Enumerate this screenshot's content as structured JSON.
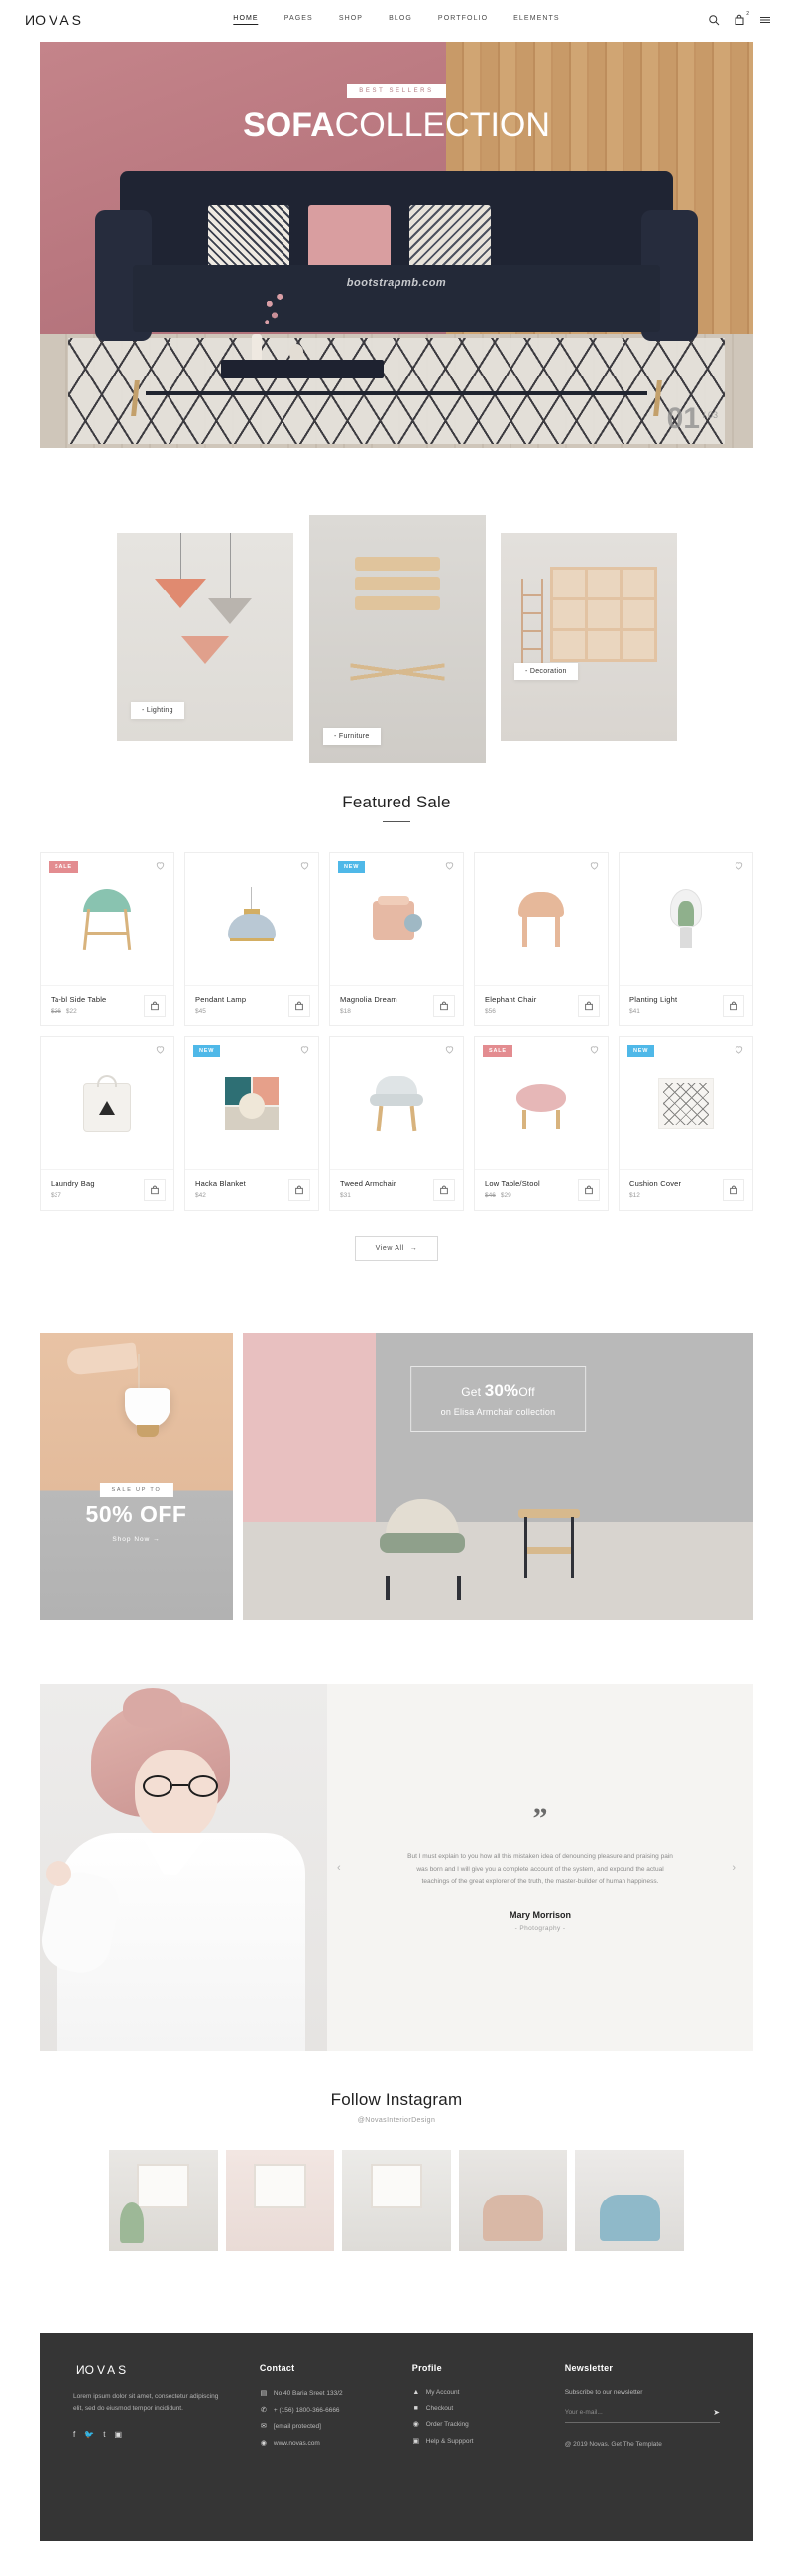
{
  "header": {
    "logo": "NOVAS",
    "nav": [
      {
        "label": "HOME",
        "active": true
      },
      {
        "label": "PAGES",
        "active": false
      },
      {
        "label": "SHOP",
        "active": false
      },
      {
        "label": "BLOG",
        "active": false
      },
      {
        "label": "PORTFOLIO",
        "active": false
      },
      {
        "label": "ELEMENTS",
        "active": false
      }
    ],
    "icons": {
      "search": "search-icon",
      "cart": "bag-icon",
      "cart_count": "2",
      "menu": "hamburger-icon"
    }
  },
  "hero": {
    "badge": "BEST SELLERS",
    "title_bold": "SOFA",
    "title_light": "COLLECTION",
    "watermark": "bootstrapmb.com",
    "slide_current": "01",
    "slide_total": "/ 03"
  },
  "categories": [
    {
      "label": "- Lighting"
    },
    {
      "label": "- Furniture"
    },
    {
      "label": "- Decoration"
    }
  ],
  "featured": {
    "title": "Featured Sale",
    "view_all": "View All",
    "view_all_arrow": "→",
    "products": [
      {
        "name": "Ta-bl Side Table",
        "old_price": "$36",
        "price": "$22",
        "tag": "SALE",
        "tag_type": "sale"
      },
      {
        "name": "Pendant Lamp",
        "old_price": "",
        "price": "$45",
        "tag": "",
        "tag_type": ""
      },
      {
        "name": "Magnolia Dream",
        "old_price": "",
        "price": "$18",
        "tag": "NEW",
        "tag_type": "new"
      },
      {
        "name": "Elephant Chair",
        "old_price": "",
        "price": "$56",
        "tag": "",
        "tag_type": ""
      },
      {
        "name": "Planting Light",
        "old_price": "",
        "price": "$41",
        "tag": "",
        "tag_type": ""
      },
      {
        "name": "Laundry Bag",
        "old_price": "",
        "price": "$37",
        "tag": "",
        "tag_type": ""
      },
      {
        "name": "Hacka Blanket",
        "old_price": "",
        "price": "$42",
        "tag": "NEW",
        "tag_type": "new"
      },
      {
        "name": "Tweed Armchair",
        "old_price": "",
        "price": "$31",
        "tag": "",
        "tag_type": ""
      },
      {
        "name": "Low Table/Stool",
        "old_price": "$46",
        "price": "$29",
        "tag": "SALE",
        "tag_type": "sale"
      },
      {
        "name": "Cushion Cover",
        "old_price": "",
        "price": "$12",
        "tag": "NEW",
        "tag_type": "new"
      }
    ]
  },
  "promos": {
    "left": {
      "badge": "SALE UP TO",
      "headline": "50% OFF",
      "cta": "Shop Now  →"
    },
    "right": {
      "line1_pre": "Get ",
      "line1_big": "30%",
      "line1_post": "Off",
      "line2": "on Elisa Armchair collection"
    }
  },
  "testimonial": {
    "quote_glyph": "”",
    "text": "But I must explain to you how all this mistaken idea of denouncing pleasure and praising pain was born and I will give you a complete account of the system, and expound the actual teachings of the great explorer of the truth, the master-builder of human happiness.",
    "name": "Mary Morrison",
    "role": "- Photography -",
    "prev": "‹",
    "next": "›"
  },
  "instagram": {
    "title": "Follow Instagram",
    "handle": "@NovasInteriorDesign"
  },
  "footer": {
    "logo": "NOVAS",
    "description": "Lorem ipsum dolor sit amet, consectetur adipiscing elit, sed do eiusmod tempor incididunt.",
    "social": [
      "f",
      "🐦",
      "t",
      "▣"
    ],
    "contact": {
      "title": "Contact",
      "items": [
        {
          "icon": "▤",
          "text": "No 40 Baria Sreet 133/2"
        },
        {
          "icon": "✆",
          "text": "+ (156) 1800-366-6666"
        },
        {
          "icon": "✉",
          "text": "[email protected]"
        },
        {
          "icon": "◉",
          "text": "www.novas.com"
        }
      ]
    },
    "profile": {
      "title": "Profile",
      "items": [
        {
          "icon": "▲",
          "text": "My Account"
        },
        {
          "icon": "■",
          "text": "Checkout"
        },
        {
          "icon": "◉",
          "text": "Order Tracking"
        },
        {
          "icon": "▣",
          "text": "Help & Suppport"
        }
      ]
    },
    "newsletter": {
      "title": "Newsletter",
      "subtitle": "Subscribe to our newsletter",
      "placeholder": "Your e-mail...",
      "send_icon": "➤",
      "copyright": "@ 2019 Novas. Get The Template"
    }
  }
}
